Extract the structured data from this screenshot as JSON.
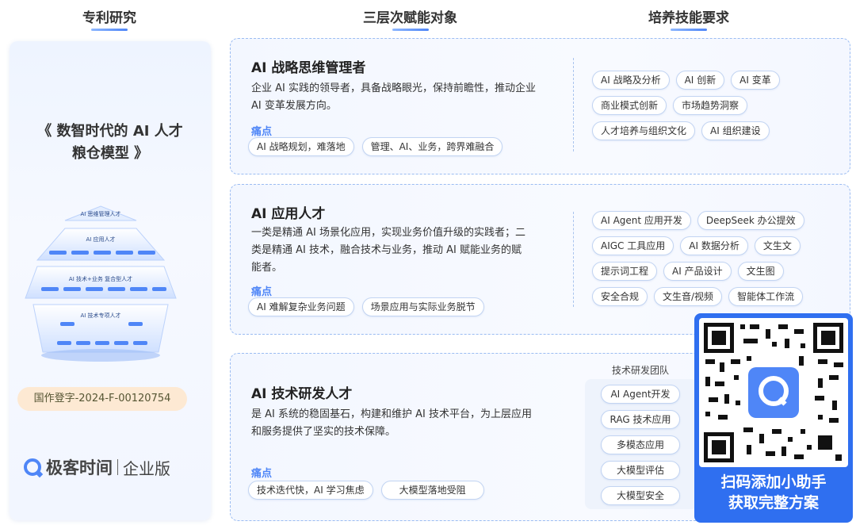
{
  "columns": {
    "patent": "专利研究",
    "targets": "三层次赋能对象",
    "skills": "培养技能要求"
  },
  "left_panel": {
    "title_line1": "《 数智时代的 AI 人才",
    "title_line2": "粮仓模型 》",
    "pyramid": {
      "tier1": "AI 思维管理人才",
      "tier2": "AI 应用人才",
      "tier3": "AI 技术+业务 复合型人才",
      "tier4": "AI 技术专项人才"
    },
    "registration": "国作登字-2024-F-00120754",
    "brand_name": "极客时间",
    "brand_sub": "企业版"
  },
  "cards": [
    {
      "title": "AI 战略思维管理者",
      "desc": "企业 AI 实践的领导者，具备战略眼光，保持前瞻性，推动企业 AI 变革发展方向。",
      "pain_label": "痛点",
      "pains": [
        "AI 战略规划，难落地",
        "管理、AI、业务，跨界难融合"
      ],
      "skills": [
        [
          "AI 战略及分析",
          "AI 创新",
          "AI 变革"
        ],
        [
          "商业模式创新",
          "市场趋势洞察"
        ],
        [
          "人才培养与组织文化",
          "AI 组织建设"
        ]
      ]
    },
    {
      "title": "AI 应用人才",
      "desc": "一类是精通 AI 场景化应用，实现业务价值升级的实践者；二类是精通 AI 技术，融合技术与业务，推动 AI 赋能业务的赋能者。",
      "pain_label": "痛点",
      "pains": [
        "AI 难解复杂业务问题",
        "场景应用与实际业务脱节"
      ],
      "skills": [
        [
          "AI Agent 应用开发",
          "DeepSeek 办公提效"
        ],
        [
          "AIGC 工具应用",
          "AI 数据分析",
          "文生文"
        ],
        [
          "提示词工程",
          "AI 产品设计",
          "文生图"
        ],
        [
          "安全合规",
          "文生音/视频",
          "智能体工作流"
        ]
      ]
    },
    {
      "title": "AI 技术研发人才",
      "desc": "是 AI 系统的稳固基石，构建和维护 AI 技术平台，为上层应用和服务提供了坚实的技术保障。",
      "pain_label": "痛点",
      "pains": [
        "技术迭代快，AI 学习焦虑",
        "大模型落地受阻"
      ],
      "team_label": "技术研发团队",
      "team": [
        "AI Agent开发",
        "RAG 技术应用",
        "多模态应用",
        "大模型评估",
        "大模型安全"
      ]
    }
  ],
  "qr": {
    "line1": "扫码添加小助手",
    "line2": "获取完整方案"
  },
  "colors": {
    "accent": "#4f86f7",
    "qr_bg": "#2f6ff0",
    "badge_bg": "#fde9d3"
  }
}
